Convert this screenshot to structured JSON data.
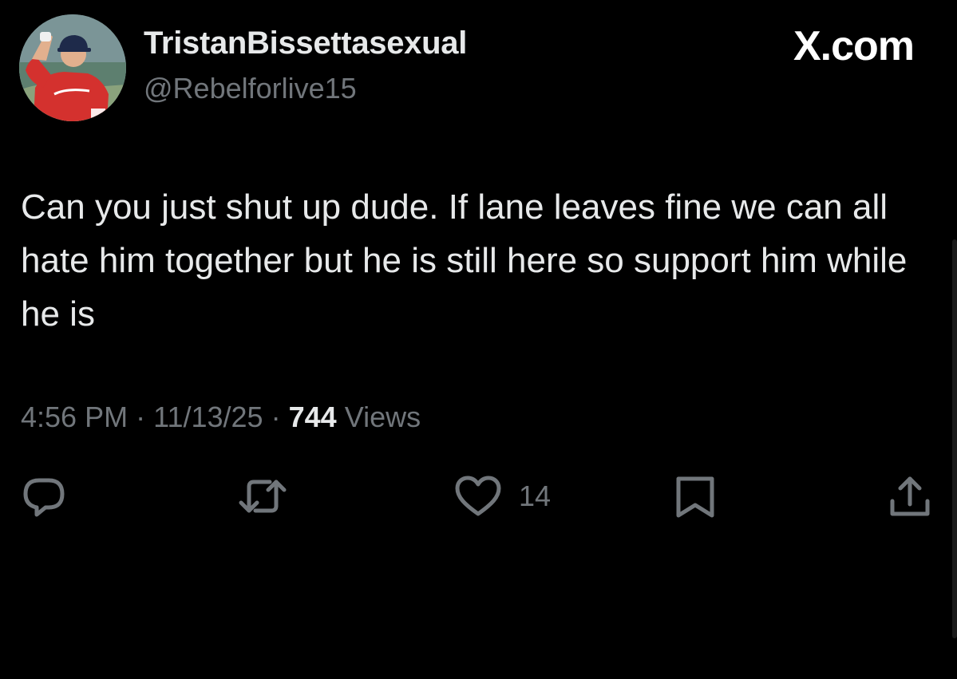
{
  "tweet": {
    "display_name": "TristanBissettasexual",
    "handle": "@Rebelforlive15",
    "brand": "X.com",
    "text": "Can you just shut up dude. If lane leaves fine we can all hate him together but he is still here so support him while he is",
    "time": "4:56 PM",
    "date": "11/13/25",
    "separator": "·",
    "views_count": "744",
    "views_label": "Views",
    "like_count": "14"
  },
  "icons": {
    "reply": "speech-bubble",
    "retweet": "repost-arrows",
    "like": "heart-outline",
    "bookmark": "bookmark-outline",
    "share": "share-upload"
  },
  "colors": {
    "background": "#000000",
    "primary_text": "#e7e9ea",
    "secondary_text": "#71767b",
    "icon": "#71767b"
  }
}
